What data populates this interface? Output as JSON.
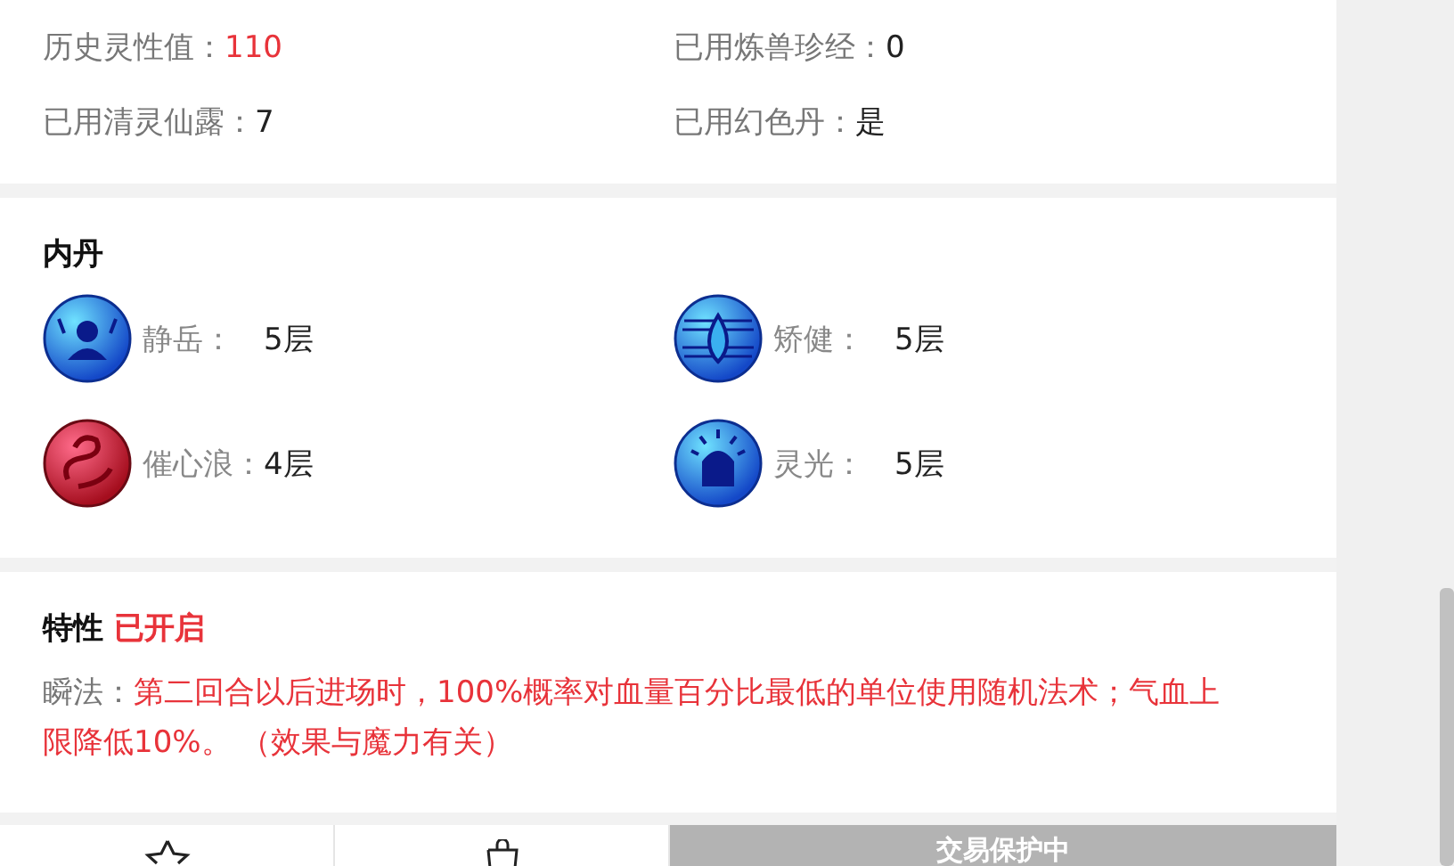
{
  "stats": [
    {
      "label": "历史灵性值：",
      "value": "110",
      "highlight": true
    },
    {
      "label": "已用炼兽珍经：",
      "value": "0",
      "highlight": false
    },
    {
      "label": "已用清灵仙露：",
      "value": "7",
      "highlight": false
    },
    {
      "label": "已用幻色丹：",
      "value": "是",
      "highlight": false
    }
  ],
  "neidan": {
    "title": "内丹",
    "items": [
      {
        "name": "静岳：",
        "level": "5层",
        "kind": "guard"
      },
      {
        "name": "矫健：",
        "level": "5层",
        "kind": "drop"
      },
      {
        "name": "催心浪：",
        "level": "4层",
        "kind": "swirl"
      },
      {
        "name": "灵光：",
        "level": "5层",
        "kind": "halo"
      }
    ]
  },
  "trait": {
    "title": "特性",
    "status": "已开启",
    "enabled": true,
    "label": "瞬法：",
    "description": "第二回合以后进场时，100%概率对血量百分比最低的单位使用随机法术；气血上限降低10%。 （效果与魔力有关）"
  },
  "bottom_bar": {
    "protect_label": "交易保护中"
  }
}
